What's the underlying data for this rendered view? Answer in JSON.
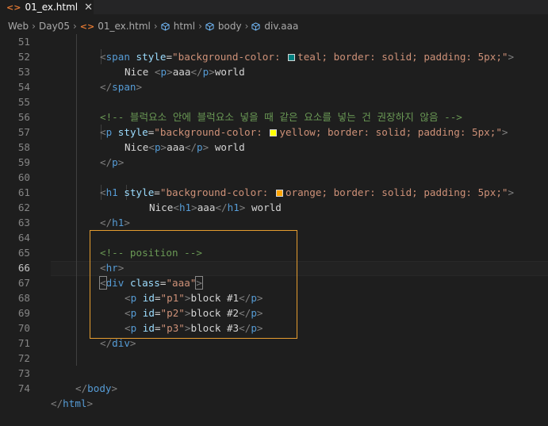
{
  "tab": {
    "label": "01_ex.html",
    "icon": "html-file-icon",
    "close": "✕"
  },
  "breadcrumb": {
    "items": [
      "Web",
      "Day05",
      "01_ex.html",
      "html",
      "body",
      "div.aaa"
    ]
  },
  "colors": {
    "teal": "#008080",
    "yellow": "#ffff00",
    "orange": "#ffa500",
    "selection_border": "#e59d30"
  },
  "lines": [
    {
      "n": "51"
    },
    {
      "n": "52"
    },
    {
      "n": "53"
    },
    {
      "n": "54"
    },
    {
      "n": "55"
    },
    {
      "n": "56"
    },
    {
      "n": "57"
    },
    {
      "n": "58"
    },
    {
      "n": "59"
    },
    {
      "n": "60"
    },
    {
      "n": "61"
    },
    {
      "n": "62"
    },
    {
      "n": "63"
    },
    {
      "n": "64"
    },
    {
      "n": "65"
    },
    {
      "n": "66"
    },
    {
      "n": "67"
    },
    {
      "n": "68"
    },
    {
      "n": "69"
    },
    {
      "n": "70"
    },
    {
      "n": "71"
    },
    {
      "n": "72"
    },
    {
      "n": "73"
    },
    {
      "n": "74"
    }
  ],
  "code": {
    "l51": {
      "tag": "span",
      "attr": "style",
      "val1": "\"background-color: ",
      "color": "teal",
      "val2": "; border: solid; padding: 5px;\""
    },
    "l52": {
      "t1": "Nice ",
      "tag": "p",
      "inner": "aaa",
      "t2": "world"
    },
    "l53": {
      "tag": "span"
    },
    "l55": {
      "comment": "<!-- 블럭요소 안에 블럭요소 넣을 때 같은 요소를 넣는 건 권장하지 않음 -->"
    },
    "l56": {
      "tag": "p",
      "attr": "style",
      "val1": "\"background-color: ",
      "color": "yellow",
      "val2": "; border: solid; padding: 5px;\""
    },
    "l57": {
      "t1": "Nice",
      "tag": "p",
      "inner": "aaa",
      "t2": " world"
    },
    "l58": {
      "tag": "p"
    },
    "l60": {
      "tag": "h1",
      "attr": "style",
      "val1": "\"background-color: ",
      "color": "orange",
      "val2": "; border: solid; padding: 5px;\""
    },
    "l61": {
      "t1": "Nice",
      "tag": "h1",
      "inner": "aaa",
      "t2": " world"
    },
    "l62": {
      "tag": "h1"
    },
    "l64": {
      "comment": "<!-- position -->"
    },
    "l65": {
      "tag": "hr"
    },
    "l66": {
      "tag": "div",
      "attr": "class",
      "val": "\"aaa\""
    },
    "l67": {
      "tag": "p",
      "attr": "id",
      "val": "\"p1\"",
      "inner": "block #1"
    },
    "l68": {
      "tag": "p",
      "attr": "id",
      "val": "\"p2\"",
      "inner": "block #2"
    },
    "l69": {
      "tag": "p",
      "attr": "id",
      "val": "\"p3\"",
      "inner": "block #3"
    },
    "l70": {
      "tag": "div"
    },
    "l73": {
      "tag": "body"
    },
    "l74": {
      "tag": "html"
    }
  }
}
